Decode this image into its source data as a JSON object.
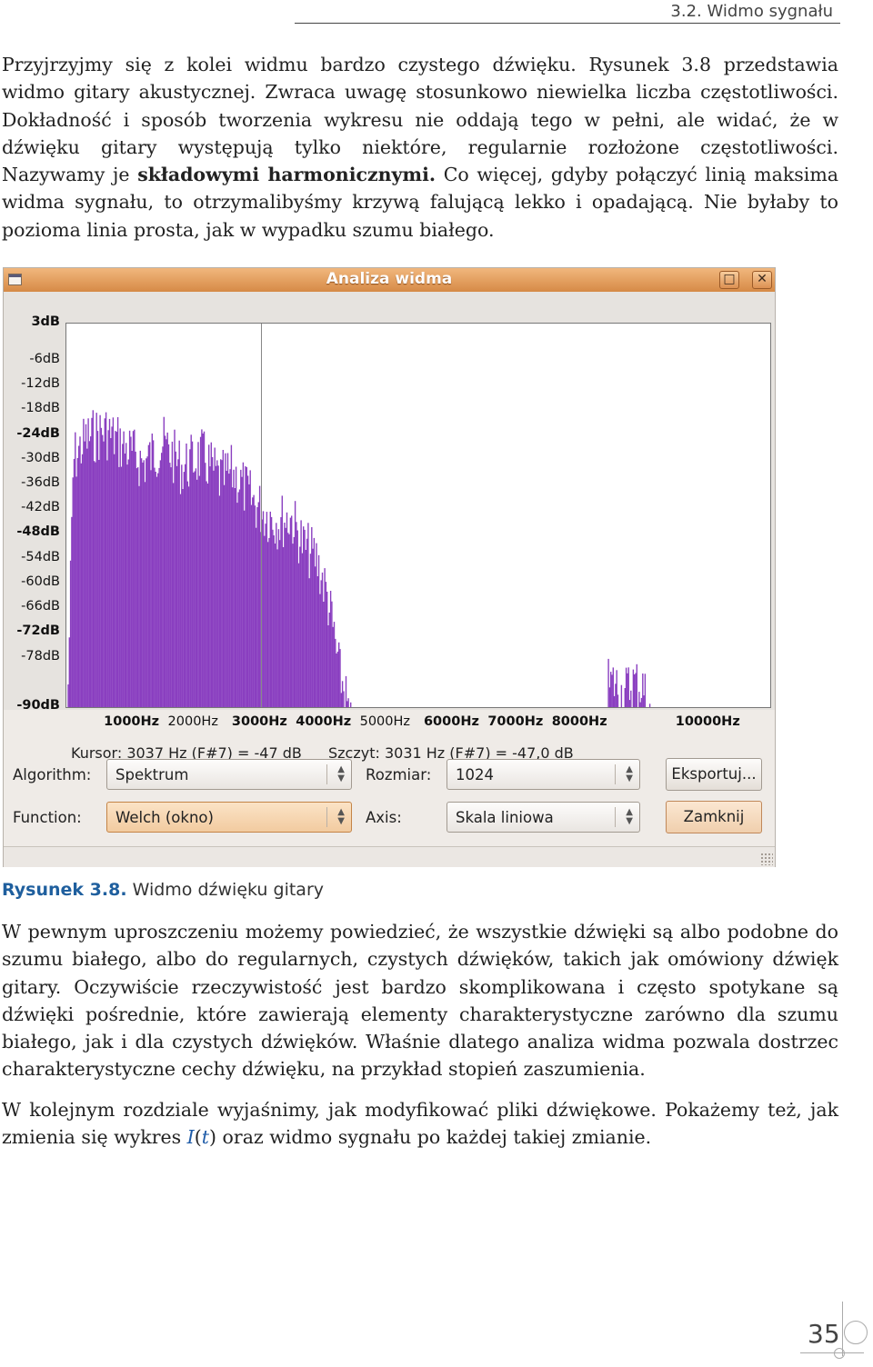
{
  "header": {
    "title": "3.2. Widmo sygnału"
  },
  "paragraph1": {
    "text_before": "Przyjrzyjmy się z kolei widmu bardzo czystego dźwięku. Rysunek 3.8 przedstawia widmo gitary akustycznej. Zwraca uwagę stosunkowo niewielka liczba częstotliwości. Dokładność i sposób tworzenia wykresu nie oddają tego w pełni, ale widać, że w dźwięku gitary występują tylko niektóre, regularnie rozłożone częstotliwości. Nazywamy je ",
    "term": "składowymi harmonicznymi.",
    "text_after": " Co więcej, gdyby połączyć linią maksima widma sygnału, to otrzymalibyśmy krzywą falującą lekko i opadającą. Nie byłaby to pozioma linia prosta, jak w wypadku szumu białego."
  },
  "window": {
    "title": "Analiza widma",
    "maximize_label": "□",
    "close_label": "✕",
    "cursor_text": "Kursor: 3037 Hz (F#7) = -47 dB",
    "peak_text": "Szczyt: 3031 Hz (F#7) = -47,0 dB",
    "algorithm_label": "Algorithm:",
    "algorithm_value": "Spektrum",
    "size_label": "Rozmiar:",
    "size_value": "1024",
    "export_label": "Eksportuj...",
    "function_label": "Function:",
    "function_value": "Welch (okno)",
    "axis_label": "Axis:",
    "axis_value": "Skala liniowa",
    "close_button_label": "Zamknij",
    "colors": {
      "titlebar": "#e09a58",
      "bars": "#8a3fc0"
    }
  },
  "chart_data": {
    "type": "bar",
    "y_ticks": [
      {
        "label": "3dB",
        "value": 3,
        "bold": true
      },
      {
        "label": "-6dB",
        "value": -6,
        "bold": false
      },
      {
        "label": "-12dB",
        "value": -12,
        "bold": false
      },
      {
        "label": "-18dB",
        "value": -18,
        "bold": false
      },
      {
        "label": "-24dB",
        "value": -24,
        "bold": true
      },
      {
        "label": "-30dB",
        "value": -30,
        "bold": false
      },
      {
        "label": "-36dB",
        "value": -36,
        "bold": false
      },
      {
        "label": "-42dB",
        "value": -42,
        "bold": false
      },
      {
        "label": "-48dB",
        "value": -48,
        "bold": true
      },
      {
        "label": "-54dB",
        "value": -54,
        "bold": false
      },
      {
        "label": "-60dB",
        "value": -60,
        "bold": false
      },
      {
        "label": "-66dB",
        "value": -66,
        "bold": false
      },
      {
        "label": "-72dB",
        "value": -72,
        "bold": true
      },
      {
        "label": "-78dB",
        "value": -78,
        "bold": false
      },
      {
        "label": "-90dB",
        "value": -90,
        "bold": true
      }
    ],
    "x_ticks": [
      {
        "label": "1000Hz",
        "value": 1000,
        "bold": true
      },
      {
        "label": "2000Hz",
        "value": 2000,
        "bold": false
      },
      {
        "label": "3000Hz",
        "value": 3000,
        "bold": true
      },
      {
        "label": "4000Hz",
        "value": 4000,
        "bold": true
      },
      {
        "label": "5000Hz",
        "value": 5000,
        "bold": false
      },
      {
        "label": "6000Hz",
        "value": 6000,
        "bold": true
      },
      {
        "label": "7000Hz",
        "value": 7000,
        "bold": true
      },
      {
        "label": "8000Hz",
        "value": 8000,
        "bold": true
      },
      {
        "label": "10000Hz",
        "value": 10000,
        "bold": true
      }
    ],
    "xlim": [
      0,
      11000
    ],
    "ylim": [
      -90,
      3
    ],
    "grid": false,
    "cursor_x": 3037,
    "envelope": [
      [
        0,
        -90
      ],
      [
        100,
        -23
      ],
      [
        300,
        -18
      ],
      [
        600,
        -16
      ],
      [
        900,
        -20
      ],
      [
        1200,
        -24
      ],
      [
        1500,
        -19
      ],
      [
        1800,
        -25
      ],
      [
        2100,
        -22
      ],
      [
        2400,
        -28
      ],
      [
        2600,
        -26
      ],
      [
        2900,
        -33
      ],
      [
        3100,
        -36
      ],
      [
        3300,
        -38
      ],
      [
        3500,
        -37
      ],
      [
        3700,
        -44
      ],
      [
        3900,
        -47
      ],
      [
        4050,
        -55
      ],
      [
        4150,
        -63
      ],
      [
        4250,
        -74
      ],
      [
        4350,
        -80
      ],
      [
        4450,
        -90
      ],
      [
        8400,
        -90
      ],
      [
        8450,
        -78
      ],
      [
        8550,
        -77
      ],
      [
        8700,
        -80
      ],
      [
        8850,
        -77
      ],
      [
        9000,
        -78
      ],
      [
        9100,
        -84
      ],
      [
        9200,
        -90
      ]
    ]
  },
  "caption": {
    "label": "Rysunek 3.8.",
    "text": " Widmo dźwięku gitary"
  },
  "paragraph2": {
    "text": "W pewnym uproszczeniu możemy powiedzieć, że wszystkie dźwięki są albo podobne do szumu białego, albo do regularnych, czystych dźwięków, takich jak omówiony dźwięk gitary. Oczywiście rzeczywistość jest bardzo skomplikowana i często spotykane są dźwięki pośrednie, które zawierają elementy charakterystyczne zarówno dla szumu białego, jak i dla czystych dźwięków. Właśnie dlatego analiza widma pozwala dostrzec charakterystyczne cechy dźwięku, na przykład stopień zaszumienia."
  },
  "paragraph3": {
    "text_before": "W kolejnym rozdziale wyjaśnimy, jak modyfikować pliki dźwiękowe. Pokażemy też, jak zmienia się wykres ",
    "math_i": "I",
    "math_open": "(",
    "math_t": "t",
    "math_close": ")",
    "text_after": " oraz widmo sygnału po każdej takiej zmianie."
  },
  "page_number": "35"
}
